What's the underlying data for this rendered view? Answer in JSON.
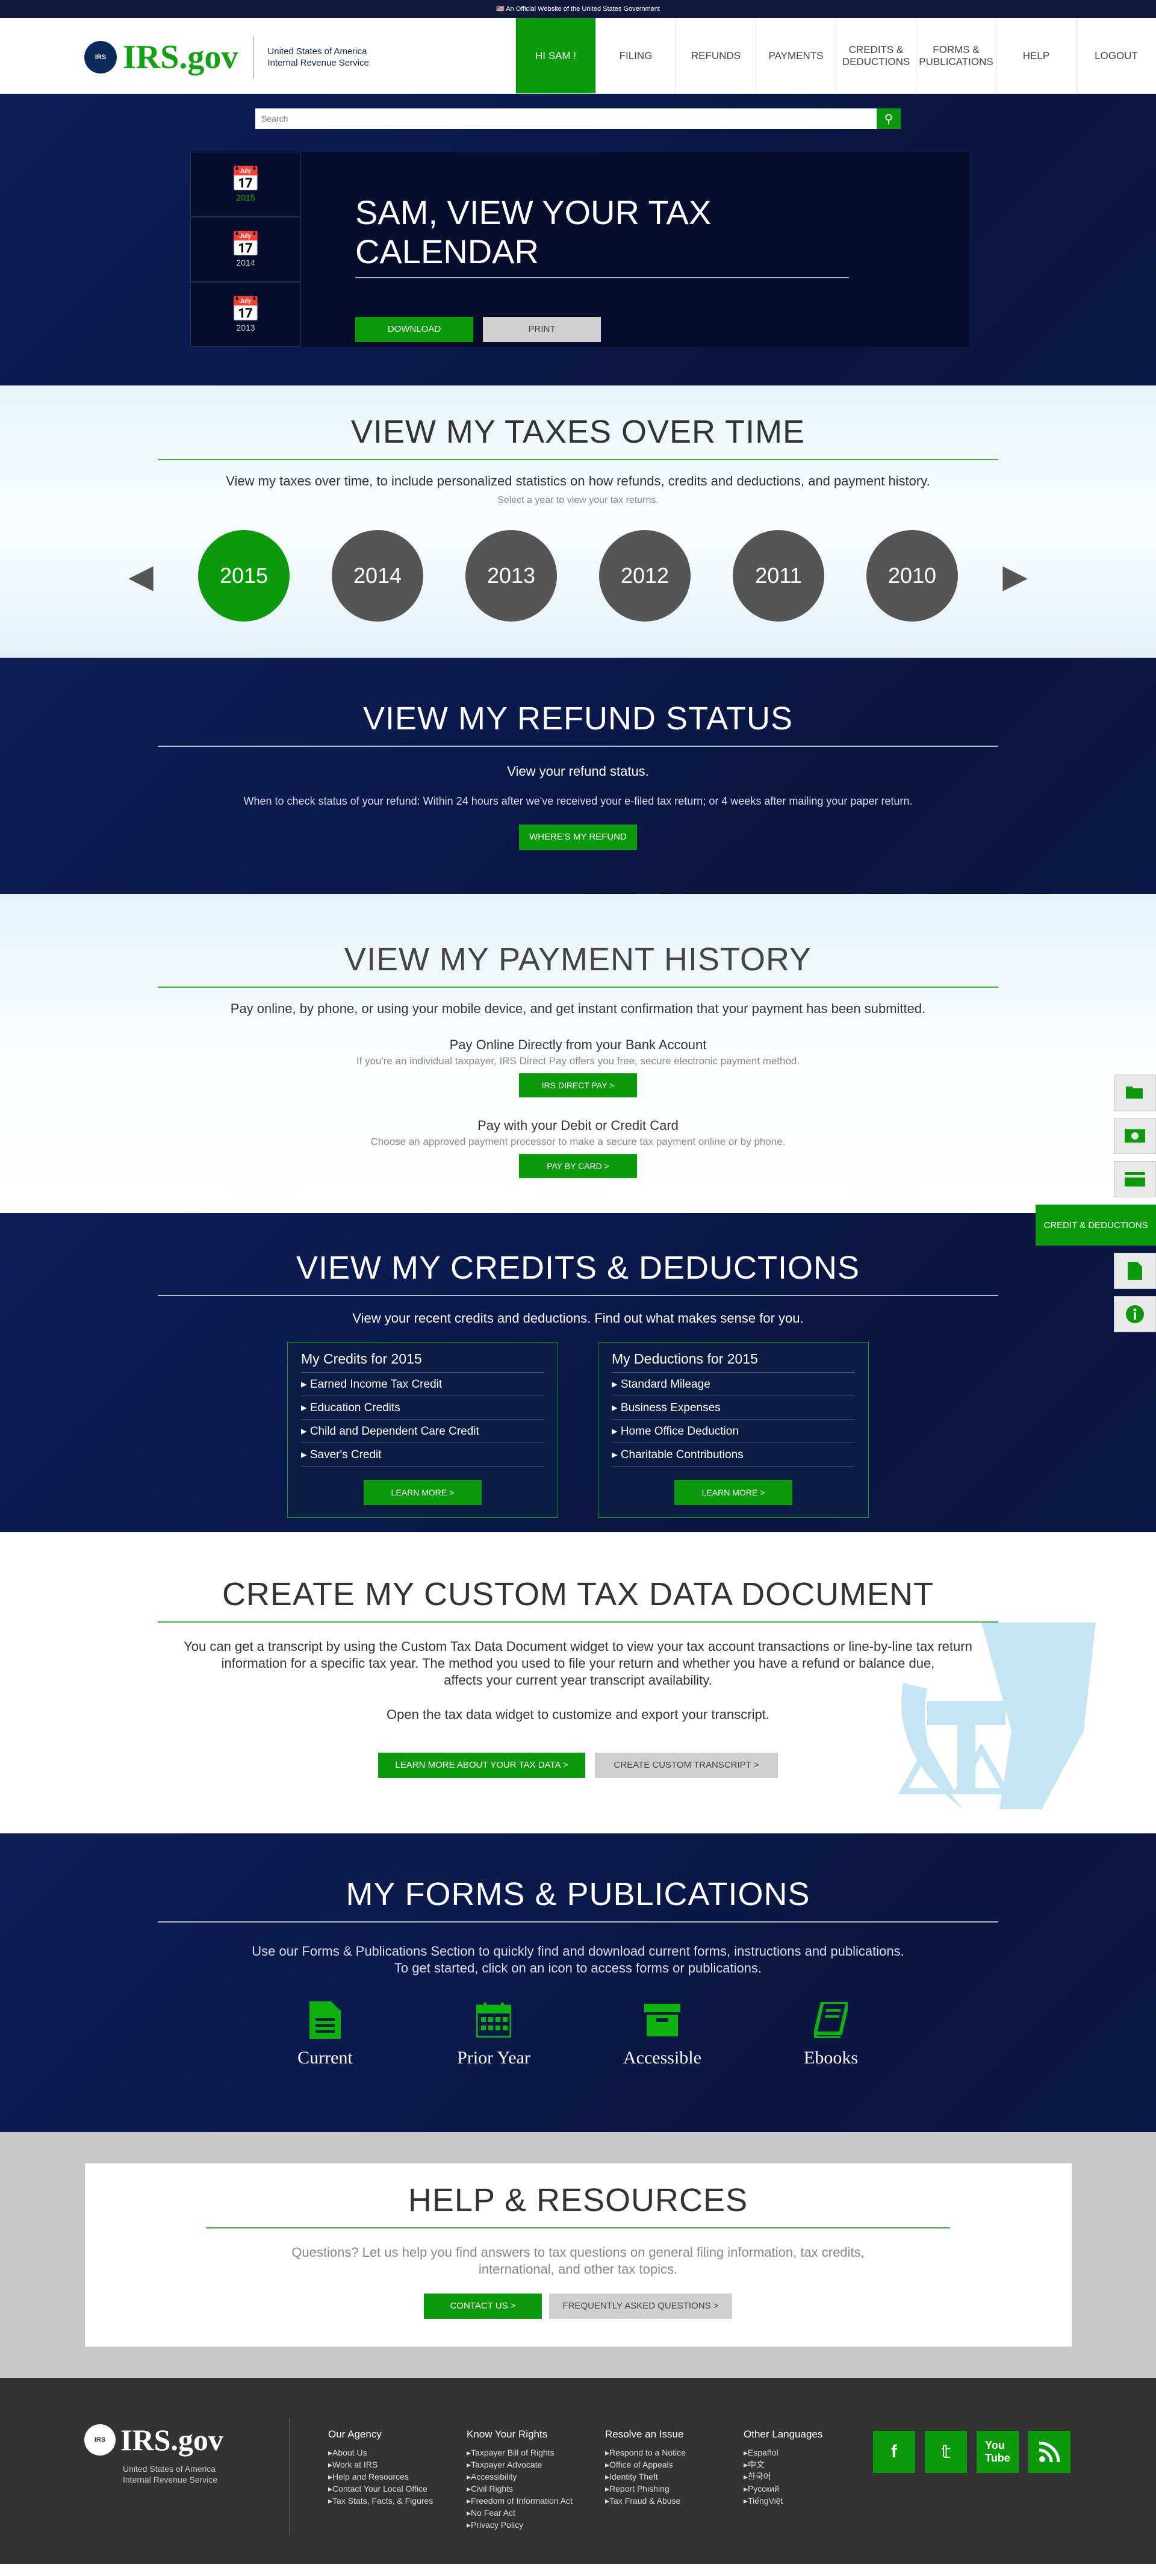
{
  "gov_banner": "An Official Website of the United States Government",
  "header": {
    "logo_name": "IRS.gov",
    "logo_sub_line1": "United States of America",
    "logo_sub_line2": "Internal Revenue Service",
    "nav": [
      {
        "label": "HI SAM !",
        "active": true
      },
      {
        "label": "FILING"
      },
      {
        "label": "REFUNDS"
      },
      {
        "label": "PAYMENTS"
      },
      {
        "label": "CREDITS & DEDUCTIONS"
      },
      {
        "label": "FORMS & PUBLICATIONS"
      },
      {
        "label": "HELP"
      },
      {
        "label": "LOGOUT"
      }
    ]
  },
  "search": {
    "placeholder": "Search"
  },
  "calendar": {
    "years": [
      "2015",
      "2014",
      "2013"
    ],
    "title": "SAM, VIEW YOUR TAX CALENDAR",
    "download_label": "DOWNLOAD",
    "print_label": "PRINT"
  },
  "over_time": {
    "title": "VIEW MY TAXES OVER TIME",
    "subtitle": "View my taxes over time, to include personalized statistics on how refunds, credits and deductions, and payment history.",
    "hint": "Select a year to view your tax returns.",
    "years": [
      "2015",
      "2014",
      "2013",
      "2012",
      "2011",
      "2010"
    ]
  },
  "refund": {
    "title": "VIEW MY REFUND STATUS",
    "p1": "View your refund status.",
    "p2": "When to check status of your refund: Within 24 hours after we've received your e-filed tax return; or 4 weeks after mailing your paper return.",
    "button": "WHERE'S MY REFUND"
  },
  "payment": {
    "title": "VIEW MY PAYMENT HISTORY",
    "p1": "Pay online, by phone, or using your mobile device, and get instant confirmation that your payment has been submitted.",
    "block1_head": "Pay Online Directly from your Bank Account",
    "block1_desc": "If you're an individual taxpayer, IRS Direct Pay offers you free, secure electronic payment method.",
    "block1_button": "IRS DIRECT PAY >",
    "block2_head": "Pay with your Debit or Credit Card",
    "block2_desc": "Choose an approved payment processor to make a secure tax payment online or by phone.",
    "block2_button": "PAY BY CARD >"
  },
  "credits": {
    "title": "VIEW MY CREDITS & DEDUCTIONS",
    "p1": "View your recent credits and deductions.  Find out what makes sense for you.",
    "credits_head": "My Credits for 2015",
    "credits_items": [
      "Earned Income Tax Credit",
      "Education Credits",
      "Child and Dependent Care Credit",
      "Saver's Credit"
    ],
    "deductions_head": "My Deductions for 2015",
    "deductions_items": [
      "Standard Mileage",
      "Business Expenses",
      "Home Office Deduction",
      "Charitable Contributions"
    ],
    "learn_more": "LEARN MORE >"
  },
  "custom_doc": {
    "title": "CREATE MY CUSTOM TAX DATA DOCUMENT",
    "p1_line1": "You can get a transcript by using the Custom Tax Data Document widget to view your tax account transactions or line-by-line tax return",
    "p1_line2": "information for a specific tax year. The method you used to file your return and whether you have a refund or balance due,",
    "p1_line3": "affects your current year transcript availability.",
    "p2": "Open the tax data widget to customize and export your transcript.",
    "btn1": "LEARN  MORE ABOUT YOUR TAX DATA >",
    "btn2": "CREATE CUSTOM TRANSCRIPT >"
  },
  "forms": {
    "title": "MY FORMS & PUBLICATIONS",
    "p1_line1": "Use our Forms & Publications Section to quickly find and download current forms, instructions and publications.",
    "p1_line2": "To get started,  click on an icon to access forms or publications.",
    "icons": [
      "Current",
      "Prior Year",
      "Accessible",
      "Ebooks"
    ]
  },
  "help": {
    "title": "HELP & RESOURCES",
    "p1_line1": "Questions? Let us help you find answers to tax questions on general filing information, tax credits,",
    "p1_line2": "international, and other tax topics.",
    "btn1": "CONTACT US >",
    "btn2": "FREQUENTLY ASKED QUESTIONS >"
  },
  "footer": {
    "logo_name": "IRS.gov",
    "logo_sub_line1": "United States of America",
    "logo_sub_line2": "Internal Revenue Service",
    "columns": [
      {
        "head": "Our Agency",
        "items": [
          "About Us",
          "Work at IRS",
          "Help and Resources",
          "Contact Your Local Office",
          "Tax Stats, Facts, & Figures"
        ]
      },
      {
        "head": "Know Your Rights",
        "items": [
          "Taxpayer Bill of Rights",
          "Taxpayer Advocate",
          "Accessibility",
          "Civil Rights",
          "Freedom of Information Act",
          "No Fear Act",
          "Privacy Policy"
        ]
      },
      {
        "head": "Resolve an Issue",
        "items": [
          "Respond to a Notice",
          "Office of Appeals",
          "Identity Theft",
          "Report Phishing",
          "Tax Fraud & Abuse"
        ]
      },
      {
        "head": "Other Languages",
        "items": [
          "Español",
          "中文",
          "한국어",
          "Русский",
          "TiếngViệt"
        ]
      }
    ],
    "social": [
      "facebook-icon",
      "twitter-icon",
      "youtube-icon",
      "rss-icon"
    ]
  },
  "sidebar": {
    "active_label": "CREDIT & DEDUCTIONS"
  },
  "colors": {
    "accent_green": "#0b9a0b",
    "navy": "#0e1f57",
    "footer": "#333333"
  }
}
